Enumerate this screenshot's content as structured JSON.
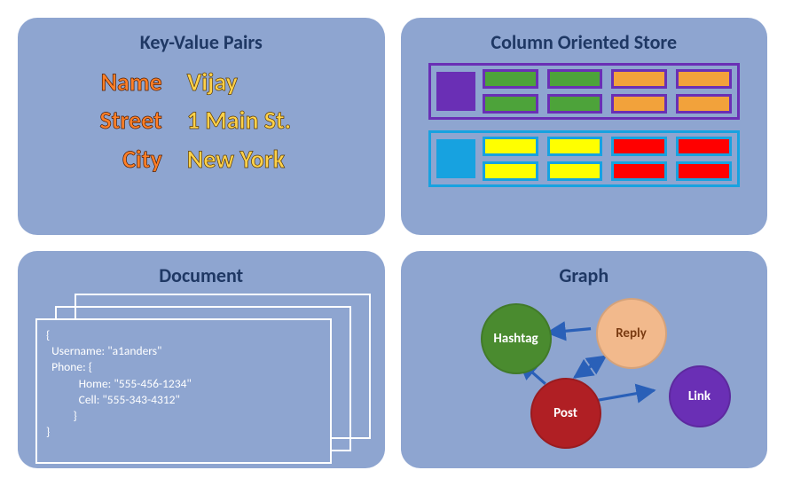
{
  "cards": {
    "kv": {
      "title": "Key-Value Pairs",
      "pairs": [
        {
          "key": "Name",
          "value": "Vijay"
        },
        {
          "key": "Street",
          "value": "1 Main St."
        },
        {
          "key": "City",
          "value": "New York"
        }
      ]
    },
    "column": {
      "title": "Column Oriented Store",
      "families": [
        {
          "theme": "purple",
          "cells": [
            "green",
            "green",
            "orange",
            "orange",
            "green",
            "green",
            "orange",
            "orange"
          ]
        },
        {
          "theme": "blue",
          "cells": [
            "yellow",
            "yellow",
            "red",
            "red",
            "yellow",
            "yellow",
            "red",
            "red"
          ]
        }
      ]
    },
    "document": {
      "title": "Document",
      "body": "{\n  Username: \"a1anders\"\n  Phone: {\n            Home: \"555-456-1234\"\n            Cell: \"555-343-4312\"\n          }\n}"
    },
    "graph": {
      "title": "Graph",
      "nodes": {
        "hashtag": "Hashtag",
        "reply": "Reply",
        "post": "Post",
        "link": "Link"
      }
    }
  }
}
